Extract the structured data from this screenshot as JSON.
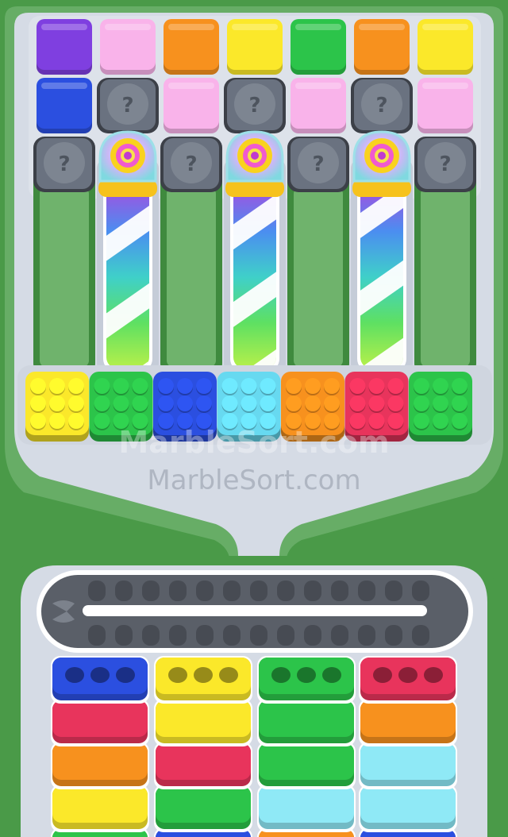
{
  "watermark": {
    "primary": "MarbleSort.com",
    "secondary": "MarbleSort.com"
  },
  "palette": {
    "purple": "#7f3fe0",
    "pink": "#f9b3ea",
    "orange": "#f7911e",
    "yellow": "#fbe82a",
    "green": "#2cc44a",
    "blue": "#2b4fe0",
    "cyan": "#67d9f0",
    "red": "#e8345c",
    "lightblue": "#8fe9f6",
    "hidden": "#6a7280"
  },
  "grid": {
    "rows": [
      [
        "purple",
        "pink",
        "orange",
        "yellow",
        "green",
        "orange",
        "yellow"
      ],
      [
        "blue",
        "hidden",
        "pink",
        "hidden",
        "pink",
        "hidden",
        "pink"
      ],
      [
        "hidden",
        "tube-top",
        "hidden",
        "tube-top",
        "hidden",
        "tube-top",
        "hidden"
      ]
    ],
    "hidden_mark": "?",
    "tube_columns": [
      1,
      3,
      5
    ]
  },
  "marble_boxes": [
    "yellow",
    "green",
    "blue",
    "cyan",
    "orange",
    "red",
    "green"
  ],
  "conveyor": {
    "slots_per_row": 13,
    "rows": 2
  },
  "stacks": [
    [
      "blue",
      "red",
      "orange",
      "yellow",
      "green"
    ],
    [
      "yellow",
      "yellow",
      "red",
      "green",
      "blue"
    ],
    [
      "green",
      "green",
      "green",
      "lightblue",
      "orange"
    ],
    [
      "red",
      "orange",
      "lightblue",
      "lightblue",
      "blue"
    ]
  ]
}
